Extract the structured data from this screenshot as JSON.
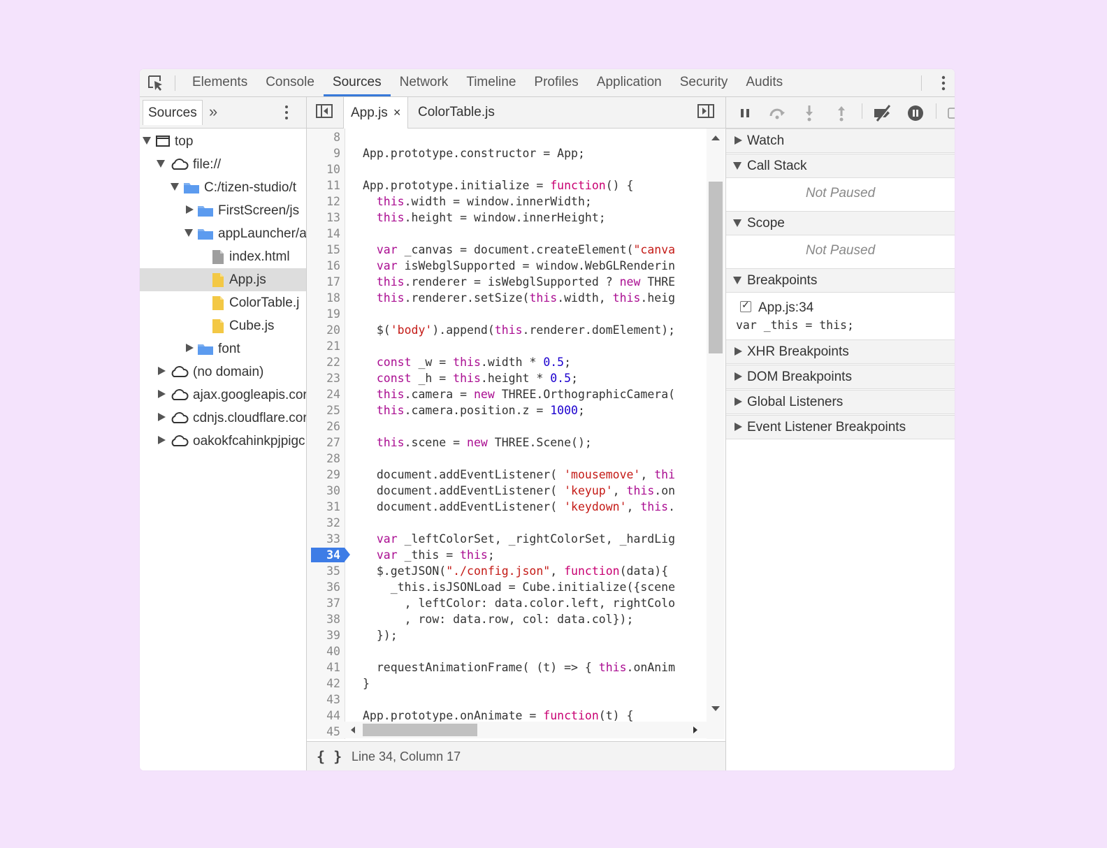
{
  "main_tabs": [
    "Elements",
    "Console",
    "Sources",
    "Network",
    "Timeline",
    "Profiles",
    "Application",
    "Security",
    "Audits"
  ],
  "active_tab": "Sources",
  "navigator": {
    "tab": "Sources",
    "more": "»",
    "tree": [
      {
        "label": "top",
        "depth": 0,
        "expander": "down",
        "icon": "frame-icon"
      },
      {
        "label": "file://",
        "depth": 1,
        "expander": "down",
        "icon": "cloud-icon"
      },
      {
        "label": "C:/tizen-studio/t",
        "depth": 2,
        "expander": "down",
        "icon": "folder-icon"
      },
      {
        "label": "FirstScreen/js",
        "depth": 3,
        "expander": "right",
        "icon": "folder-icon"
      },
      {
        "label": "appLauncher/a",
        "depth": 3,
        "expander": "down",
        "icon": "folder-icon"
      },
      {
        "label": "index.html",
        "depth": 4,
        "expander": "none",
        "icon": "html-file-icon"
      },
      {
        "label": "App.js",
        "depth": 4,
        "expander": "none",
        "icon": "js-file-icon",
        "selected": true
      },
      {
        "label": "ColorTable.j",
        "depth": 4,
        "expander": "none",
        "icon": "js-file-icon"
      },
      {
        "label": "Cube.js",
        "depth": 4,
        "expander": "none",
        "icon": "js-file-icon"
      },
      {
        "label": "font",
        "depth": 3,
        "expander": "right",
        "icon": "folder-icon"
      },
      {
        "label": "(no domain)",
        "depth": 1,
        "expander": "right",
        "icon": "cloud-icon"
      },
      {
        "label": "ajax.googleapis.cor",
        "depth": 1,
        "expander": "right",
        "icon": "cloud-icon"
      },
      {
        "label": "cdnjs.cloudflare.cor",
        "depth": 1,
        "expander": "right",
        "icon": "cloud-icon"
      },
      {
        "label": "oakokfcahinkpjpigc",
        "depth": 1,
        "expander": "right",
        "icon": "cloud-icon"
      }
    ]
  },
  "editor": {
    "tabs": [
      {
        "label": "App.js",
        "closable": true,
        "active": true
      },
      {
        "label": "ColorTable.js",
        "closable": false
      }
    ],
    "close_glyph": "×",
    "breakpoint_line": 34,
    "lines": [
      {
        "n": "8",
        "t": []
      },
      {
        "n": "9",
        "t": [
          [
            "p",
            "App.prototype.constructor = App;"
          ]
        ]
      },
      {
        "n": "10",
        "t": []
      },
      {
        "n": "11",
        "t": [
          [
            "p",
            "App.prototype.initialize = "
          ],
          [
            "fn",
            "function"
          ],
          [
            "p",
            "() {"
          ]
        ]
      },
      {
        "n": "12",
        "t": [
          [
            "p",
            "  "
          ],
          [
            "kw",
            "this"
          ],
          [
            "p",
            ".width = window.innerWidth;"
          ]
        ]
      },
      {
        "n": "13",
        "t": [
          [
            "p",
            "  "
          ],
          [
            "kw",
            "this"
          ],
          [
            "p",
            ".height = window.innerHeight;"
          ]
        ]
      },
      {
        "n": "14",
        "t": []
      },
      {
        "n": "15",
        "t": [
          [
            "p",
            "  "
          ],
          [
            "kw",
            "var"
          ],
          [
            "p",
            " _canvas = document.createElement("
          ],
          [
            "str",
            "\"canva"
          ]
        ]
      },
      {
        "n": "16",
        "t": [
          [
            "p",
            "  "
          ],
          [
            "kw",
            "var"
          ],
          [
            "p",
            " isWebglSupported = window.WebGLRenderin"
          ]
        ]
      },
      {
        "n": "17",
        "t": [
          [
            "p",
            "  "
          ],
          [
            "kw",
            "this"
          ],
          [
            "p",
            ".renderer = isWebglSupported ? "
          ],
          [
            "kw",
            "new"
          ],
          [
            "p",
            " THRE"
          ]
        ]
      },
      {
        "n": "18",
        "t": [
          [
            "p",
            "  "
          ],
          [
            "kw",
            "this"
          ],
          [
            "p",
            ".renderer.setSize("
          ],
          [
            "kw",
            "this"
          ],
          [
            "p",
            ".width, "
          ],
          [
            "kw",
            "this"
          ],
          [
            "p",
            ".heig"
          ]
        ]
      },
      {
        "n": "19",
        "t": []
      },
      {
        "n": "20",
        "t": [
          [
            "p",
            "  $("
          ],
          [
            "str",
            "'body'"
          ],
          [
            "p",
            ").append("
          ],
          [
            "kw",
            "this"
          ],
          [
            "p",
            ".renderer.domElement);"
          ]
        ]
      },
      {
        "n": "21",
        "t": []
      },
      {
        "n": "22",
        "t": [
          [
            "p",
            "  "
          ],
          [
            "kw",
            "const"
          ],
          [
            "p",
            " _w = "
          ],
          [
            "kw",
            "this"
          ],
          [
            "p",
            ".width * "
          ],
          [
            "num",
            "0.5"
          ],
          [
            "p",
            ";"
          ]
        ]
      },
      {
        "n": "23",
        "t": [
          [
            "p",
            "  "
          ],
          [
            "kw",
            "const"
          ],
          [
            "p",
            " _h = "
          ],
          [
            "kw",
            "this"
          ],
          [
            "p",
            ".height * "
          ],
          [
            "num",
            "0.5"
          ],
          [
            "p",
            ";"
          ]
        ]
      },
      {
        "n": "24",
        "t": [
          [
            "p",
            "  "
          ],
          [
            "kw",
            "this"
          ],
          [
            "p",
            ".camera = "
          ],
          [
            "kw",
            "new"
          ],
          [
            "p",
            " THREE.OrthographicCamera("
          ]
        ]
      },
      {
        "n": "25",
        "t": [
          [
            "p",
            "  "
          ],
          [
            "kw",
            "this"
          ],
          [
            "p",
            ".camera.position.z = "
          ],
          [
            "num",
            "1000"
          ],
          [
            "p",
            ";"
          ]
        ]
      },
      {
        "n": "26",
        "t": []
      },
      {
        "n": "27",
        "t": [
          [
            "p",
            "  "
          ],
          [
            "kw",
            "this"
          ],
          [
            "p",
            ".scene = "
          ],
          [
            "kw",
            "new"
          ],
          [
            "p",
            " THREE.Scene();"
          ]
        ]
      },
      {
        "n": "28",
        "t": []
      },
      {
        "n": "29",
        "t": [
          [
            "p",
            "  document.addEventListener( "
          ],
          [
            "str",
            "'mousemove'"
          ],
          [
            "p",
            ", "
          ],
          [
            "kw",
            "thi"
          ]
        ]
      },
      {
        "n": "30",
        "t": [
          [
            "p",
            "  document.addEventListener( "
          ],
          [
            "str",
            "'keyup'"
          ],
          [
            "p",
            ", "
          ],
          [
            "kw",
            "this"
          ],
          [
            "p",
            ".on"
          ]
        ]
      },
      {
        "n": "31",
        "t": [
          [
            "p",
            "  document.addEventListener( "
          ],
          [
            "str",
            "'keydown'"
          ],
          [
            "p",
            ", "
          ],
          [
            "kw",
            "this"
          ],
          [
            "p",
            "."
          ]
        ]
      },
      {
        "n": "32",
        "t": []
      },
      {
        "n": "33",
        "t": [
          [
            "p",
            "  "
          ],
          [
            "kw",
            "var"
          ],
          [
            "p",
            " _leftColorSet, _rightColorSet, _hardLig"
          ]
        ]
      },
      {
        "n": "34",
        "t": [
          [
            "p",
            "  "
          ],
          [
            "kw",
            "var"
          ],
          [
            "p",
            " _this = "
          ],
          [
            "kw",
            "this"
          ],
          [
            "p",
            ";"
          ]
        ]
      },
      {
        "n": "35",
        "t": [
          [
            "p",
            "  $.getJSON("
          ],
          [
            "str",
            "\"./config.json\""
          ],
          [
            "p",
            ", "
          ],
          [
            "fn",
            "function"
          ],
          [
            "p",
            "(data){"
          ]
        ]
      },
      {
        "n": "36",
        "t": [
          [
            "p",
            "    _this.isJSONLoad = Cube.initialize({scene"
          ]
        ]
      },
      {
        "n": "37",
        "t": [
          [
            "p",
            "      , leftColor: data.color.left, rightColo"
          ]
        ]
      },
      {
        "n": "38",
        "t": [
          [
            "p",
            "      , row: data.row, col: data.col});"
          ]
        ]
      },
      {
        "n": "39",
        "t": [
          [
            "p",
            "  });"
          ]
        ]
      },
      {
        "n": "40",
        "t": []
      },
      {
        "n": "41",
        "t": [
          [
            "p",
            "  requestAnimationFrame( (t) => { "
          ],
          [
            "kw",
            "this"
          ],
          [
            "p",
            ".onAnim"
          ]
        ]
      },
      {
        "n": "42",
        "t": [
          [
            "p",
            "}"
          ]
        ]
      },
      {
        "n": "43",
        "t": []
      },
      {
        "n": "44",
        "t": [
          [
            "p",
            "App.prototype.onAnimate = "
          ],
          [
            "fn",
            "function"
          ],
          [
            "p",
            "(t) {"
          ]
        ]
      },
      {
        "n": "45",
        "t": []
      }
    ],
    "status": "Line 34, Column 17",
    "pretty_print": "{ }"
  },
  "debugger": {
    "sections": [
      {
        "title": "Watch",
        "expanded": false
      },
      {
        "title": "Call Stack",
        "expanded": true,
        "empty_text": "Not Paused"
      },
      {
        "title": "Scope",
        "expanded": true,
        "empty_text": "Not Paused"
      },
      {
        "title": "Breakpoints",
        "expanded": true
      },
      {
        "title": "XHR Breakpoints",
        "expanded": false
      },
      {
        "title": "DOM Breakpoints",
        "expanded": false
      },
      {
        "title": "Global Listeners",
        "expanded": false
      },
      {
        "title": "Event Listener Breakpoints",
        "expanded": false
      }
    ],
    "breakpoint": {
      "label": "App.js:34",
      "code": "var _this = this;",
      "checked": true
    }
  }
}
